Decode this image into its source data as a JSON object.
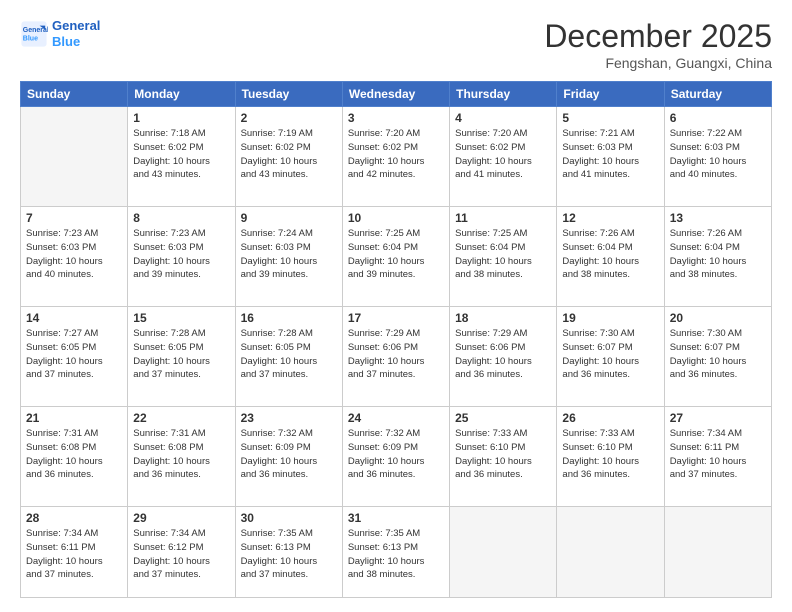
{
  "header": {
    "logo_line1": "General",
    "logo_line2": "Blue",
    "month": "December 2025",
    "location": "Fengshan, Guangxi, China"
  },
  "weekdays": [
    "Sunday",
    "Monday",
    "Tuesday",
    "Wednesday",
    "Thursday",
    "Friday",
    "Saturday"
  ],
  "weeks": [
    [
      {
        "day": "",
        "info": ""
      },
      {
        "day": "1",
        "info": "Sunrise: 7:18 AM\nSunset: 6:02 PM\nDaylight: 10 hours\nand 43 minutes."
      },
      {
        "day": "2",
        "info": "Sunrise: 7:19 AM\nSunset: 6:02 PM\nDaylight: 10 hours\nand 43 minutes."
      },
      {
        "day": "3",
        "info": "Sunrise: 7:20 AM\nSunset: 6:02 PM\nDaylight: 10 hours\nand 42 minutes."
      },
      {
        "day": "4",
        "info": "Sunrise: 7:20 AM\nSunset: 6:02 PM\nDaylight: 10 hours\nand 41 minutes."
      },
      {
        "day": "5",
        "info": "Sunrise: 7:21 AM\nSunset: 6:03 PM\nDaylight: 10 hours\nand 41 minutes."
      },
      {
        "day": "6",
        "info": "Sunrise: 7:22 AM\nSunset: 6:03 PM\nDaylight: 10 hours\nand 40 minutes."
      }
    ],
    [
      {
        "day": "7",
        "info": "Sunrise: 7:23 AM\nSunset: 6:03 PM\nDaylight: 10 hours\nand 40 minutes."
      },
      {
        "day": "8",
        "info": "Sunrise: 7:23 AM\nSunset: 6:03 PM\nDaylight: 10 hours\nand 39 minutes."
      },
      {
        "day": "9",
        "info": "Sunrise: 7:24 AM\nSunset: 6:03 PM\nDaylight: 10 hours\nand 39 minutes."
      },
      {
        "day": "10",
        "info": "Sunrise: 7:25 AM\nSunset: 6:04 PM\nDaylight: 10 hours\nand 39 minutes."
      },
      {
        "day": "11",
        "info": "Sunrise: 7:25 AM\nSunset: 6:04 PM\nDaylight: 10 hours\nand 38 minutes."
      },
      {
        "day": "12",
        "info": "Sunrise: 7:26 AM\nSunset: 6:04 PM\nDaylight: 10 hours\nand 38 minutes."
      },
      {
        "day": "13",
        "info": "Sunrise: 7:26 AM\nSunset: 6:04 PM\nDaylight: 10 hours\nand 38 minutes."
      }
    ],
    [
      {
        "day": "14",
        "info": "Sunrise: 7:27 AM\nSunset: 6:05 PM\nDaylight: 10 hours\nand 37 minutes."
      },
      {
        "day": "15",
        "info": "Sunrise: 7:28 AM\nSunset: 6:05 PM\nDaylight: 10 hours\nand 37 minutes."
      },
      {
        "day": "16",
        "info": "Sunrise: 7:28 AM\nSunset: 6:05 PM\nDaylight: 10 hours\nand 37 minutes."
      },
      {
        "day": "17",
        "info": "Sunrise: 7:29 AM\nSunset: 6:06 PM\nDaylight: 10 hours\nand 37 minutes."
      },
      {
        "day": "18",
        "info": "Sunrise: 7:29 AM\nSunset: 6:06 PM\nDaylight: 10 hours\nand 36 minutes."
      },
      {
        "day": "19",
        "info": "Sunrise: 7:30 AM\nSunset: 6:07 PM\nDaylight: 10 hours\nand 36 minutes."
      },
      {
        "day": "20",
        "info": "Sunrise: 7:30 AM\nSunset: 6:07 PM\nDaylight: 10 hours\nand 36 minutes."
      }
    ],
    [
      {
        "day": "21",
        "info": "Sunrise: 7:31 AM\nSunset: 6:08 PM\nDaylight: 10 hours\nand 36 minutes."
      },
      {
        "day": "22",
        "info": "Sunrise: 7:31 AM\nSunset: 6:08 PM\nDaylight: 10 hours\nand 36 minutes."
      },
      {
        "day": "23",
        "info": "Sunrise: 7:32 AM\nSunset: 6:09 PM\nDaylight: 10 hours\nand 36 minutes."
      },
      {
        "day": "24",
        "info": "Sunrise: 7:32 AM\nSunset: 6:09 PM\nDaylight: 10 hours\nand 36 minutes."
      },
      {
        "day": "25",
        "info": "Sunrise: 7:33 AM\nSunset: 6:10 PM\nDaylight: 10 hours\nand 36 minutes."
      },
      {
        "day": "26",
        "info": "Sunrise: 7:33 AM\nSunset: 6:10 PM\nDaylight: 10 hours\nand 36 minutes."
      },
      {
        "day": "27",
        "info": "Sunrise: 7:34 AM\nSunset: 6:11 PM\nDaylight: 10 hours\nand 37 minutes."
      }
    ],
    [
      {
        "day": "28",
        "info": "Sunrise: 7:34 AM\nSunset: 6:11 PM\nDaylight: 10 hours\nand 37 minutes."
      },
      {
        "day": "29",
        "info": "Sunrise: 7:34 AM\nSunset: 6:12 PM\nDaylight: 10 hours\nand 37 minutes."
      },
      {
        "day": "30",
        "info": "Sunrise: 7:35 AM\nSunset: 6:13 PM\nDaylight: 10 hours\nand 37 minutes."
      },
      {
        "day": "31",
        "info": "Sunrise: 7:35 AM\nSunset: 6:13 PM\nDaylight: 10 hours\nand 38 minutes."
      },
      {
        "day": "",
        "info": ""
      },
      {
        "day": "",
        "info": ""
      },
      {
        "day": "",
        "info": ""
      }
    ]
  ]
}
